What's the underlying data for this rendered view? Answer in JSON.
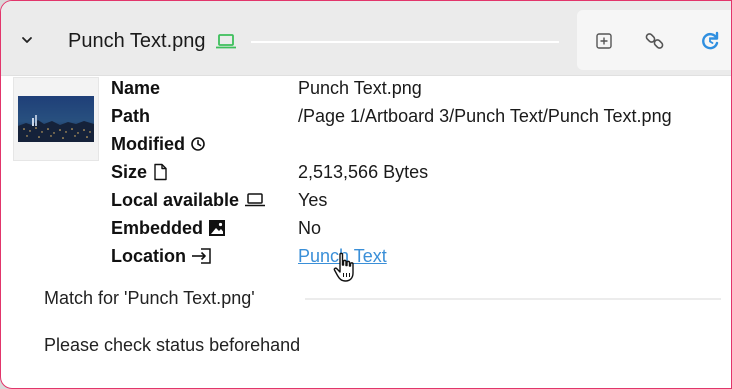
{
  "header": {
    "title": "Punch Text.png",
    "collapse_icon": "chevron-down-icon",
    "status_icon": "laptop-icon",
    "toolbar": [
      {
        "name": "add-square-icon"
      },
      {
        "name": "link-icon"
      },
      {
        "name": "refresh-icon"
      }
    ]
  },
  "colors": {
    "accent": "#e2356b",
    "link": "#3a8fd8",
    "laptop_icon": "#3cbf5b",
    "refresh_icon": "#2f8fe0"
  },
  "properties": {
    "name_label": "Name",
    "name_value": "Punch Text.png",
    "path_label": "Path",
    "path_value": "/Page 1/Artboard 3/Punch Text/Punch Text.png",
    "modified_label": "Modified",
    "modified_icon": "clock-icon",
    "size_label": "Size",
    "size_icon": "file-icon",
    "size_value": "2,513,566 Bytes",
    "local_label": "Local available",
    "local_icon": "laptop-icon",
    "local_value": "Yes",
    "embedded_label": "Embedded",
    "embedded_icon": "image-icon",
    "embedded_value": "No",
    "location_label": "Location",
    "location_icon": "enter-icon",
    "location_value": "Punch Text"
  },
  "match_text": "Match for 'Punch Text.png'",
  "status_text": "Please check status beforehand"
}
